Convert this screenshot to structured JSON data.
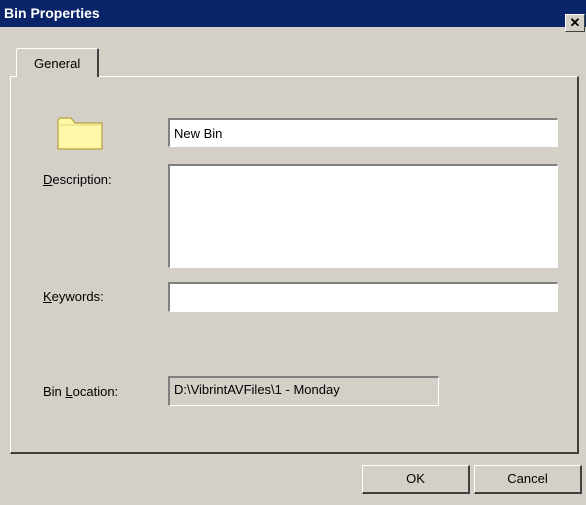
{
  "window": {
    "title": "Bin Properties",
    "close_glyph": "✕"
  },
  "tabs": [
    {
      "label": "General",
      "selected": true
    }
  ],
  "form": {
    "name_value": "New Bin",
    "description_label_mnemonic": "D",
    "description_label_rest": "escription:",
    "description_value": "",
    "keywords_label_mnemonic": "K",
    "keywords_label_rest": "eywords:",
    "keywords_value": "",
    "bin_location_label_prefix": "Bin ",
    "bin_location_label_mnemonic": "L",
    "bin_location_label_rest": "ocation:",
    "bin_location_value": "D:\\VibrintAVFiles\\1 - Monday",
    "folder_icon": "folder-icon"
  },
  "buttons": {
    "ok_label": "OK",
    "cancel_label": "Cancel"
  },
  "colors": {
    "titlebar": "#0a246a",
    "dialog_face": "#d4d0c8",
    "folder_fill": "#fff7a8",
    "folder_outline": "#b8a040"
  }
}
